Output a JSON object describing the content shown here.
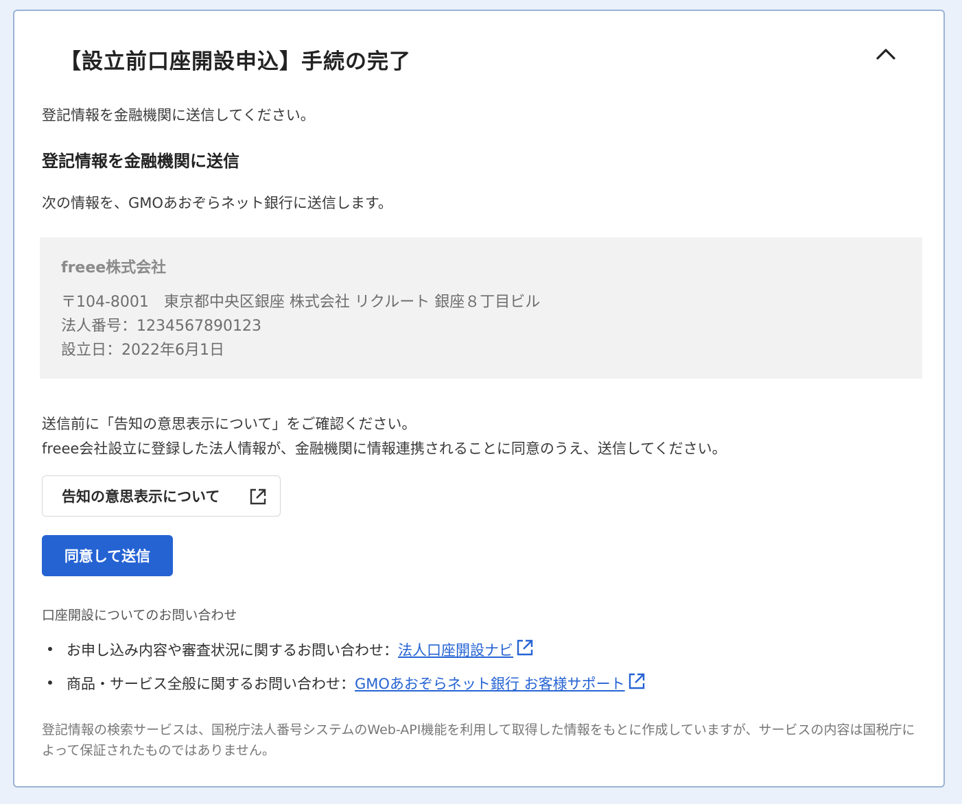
{
  "panel": {
    "title": "【設立前口座開設申込】手続の完了",
    "collapse_icon": "chevron-up-icon"
  },
  "content": {
    "lead": "登記情報を金融機関に送信してください。",
    "section_title": "登記情報を金融機関に送信",
    "intro": "次の情報を、GMOあおぞらネット銀行に送信します。"
  },
  "company_info": {
    "name": "freee株式会社",
    "address": "〒104-8001　東京都中央区銀座 株式会社 リクルート 銀座８丁目ビル",
    "corporate_number": "法人番号：1234567890123",
    "established": "設立日：2022年6月1日"
  },
  "notice": {
    "line1": "送信前に「告知の意思表示について」をご確認ください。",
    "line2": "freee会社設立に登録した法人情報が、金融機関に情報連携されることに同意のうえ、送信してください。"
  },
  "buttons": {
    "disclosure_label": "告知の意思表示について",
    "submit_label": "同意して送信"
  },
  "contact": {
    "heading": "口座開設についてのお問い合わせ",
    "items": [
      {
        "text": "お申し込み内容や審査状況に関するお問い合わせ：",
        "link": "法人口座開設ナビ"
      },
      {
        "text": "商品・サービス全般に関するお問い合わせ：",
        "link": "GMOあおぞらネット銀行 お客様サポート"
      }
    ]
  },
  "footnote": "登記情報の検索サービスは、国税庁法人番号システムのWeb-API機能を利用して取得した情報をもとに作成していますが、サービスの内容は国税庁によって保証されたものではありません。",
  "colors": {
    "primary": "#2563d3",
    "page_background": "#eaf1fb",
    "card_border": "#9ab3d6",
    "info_box_background": "#f2f2f2"
  }
}
